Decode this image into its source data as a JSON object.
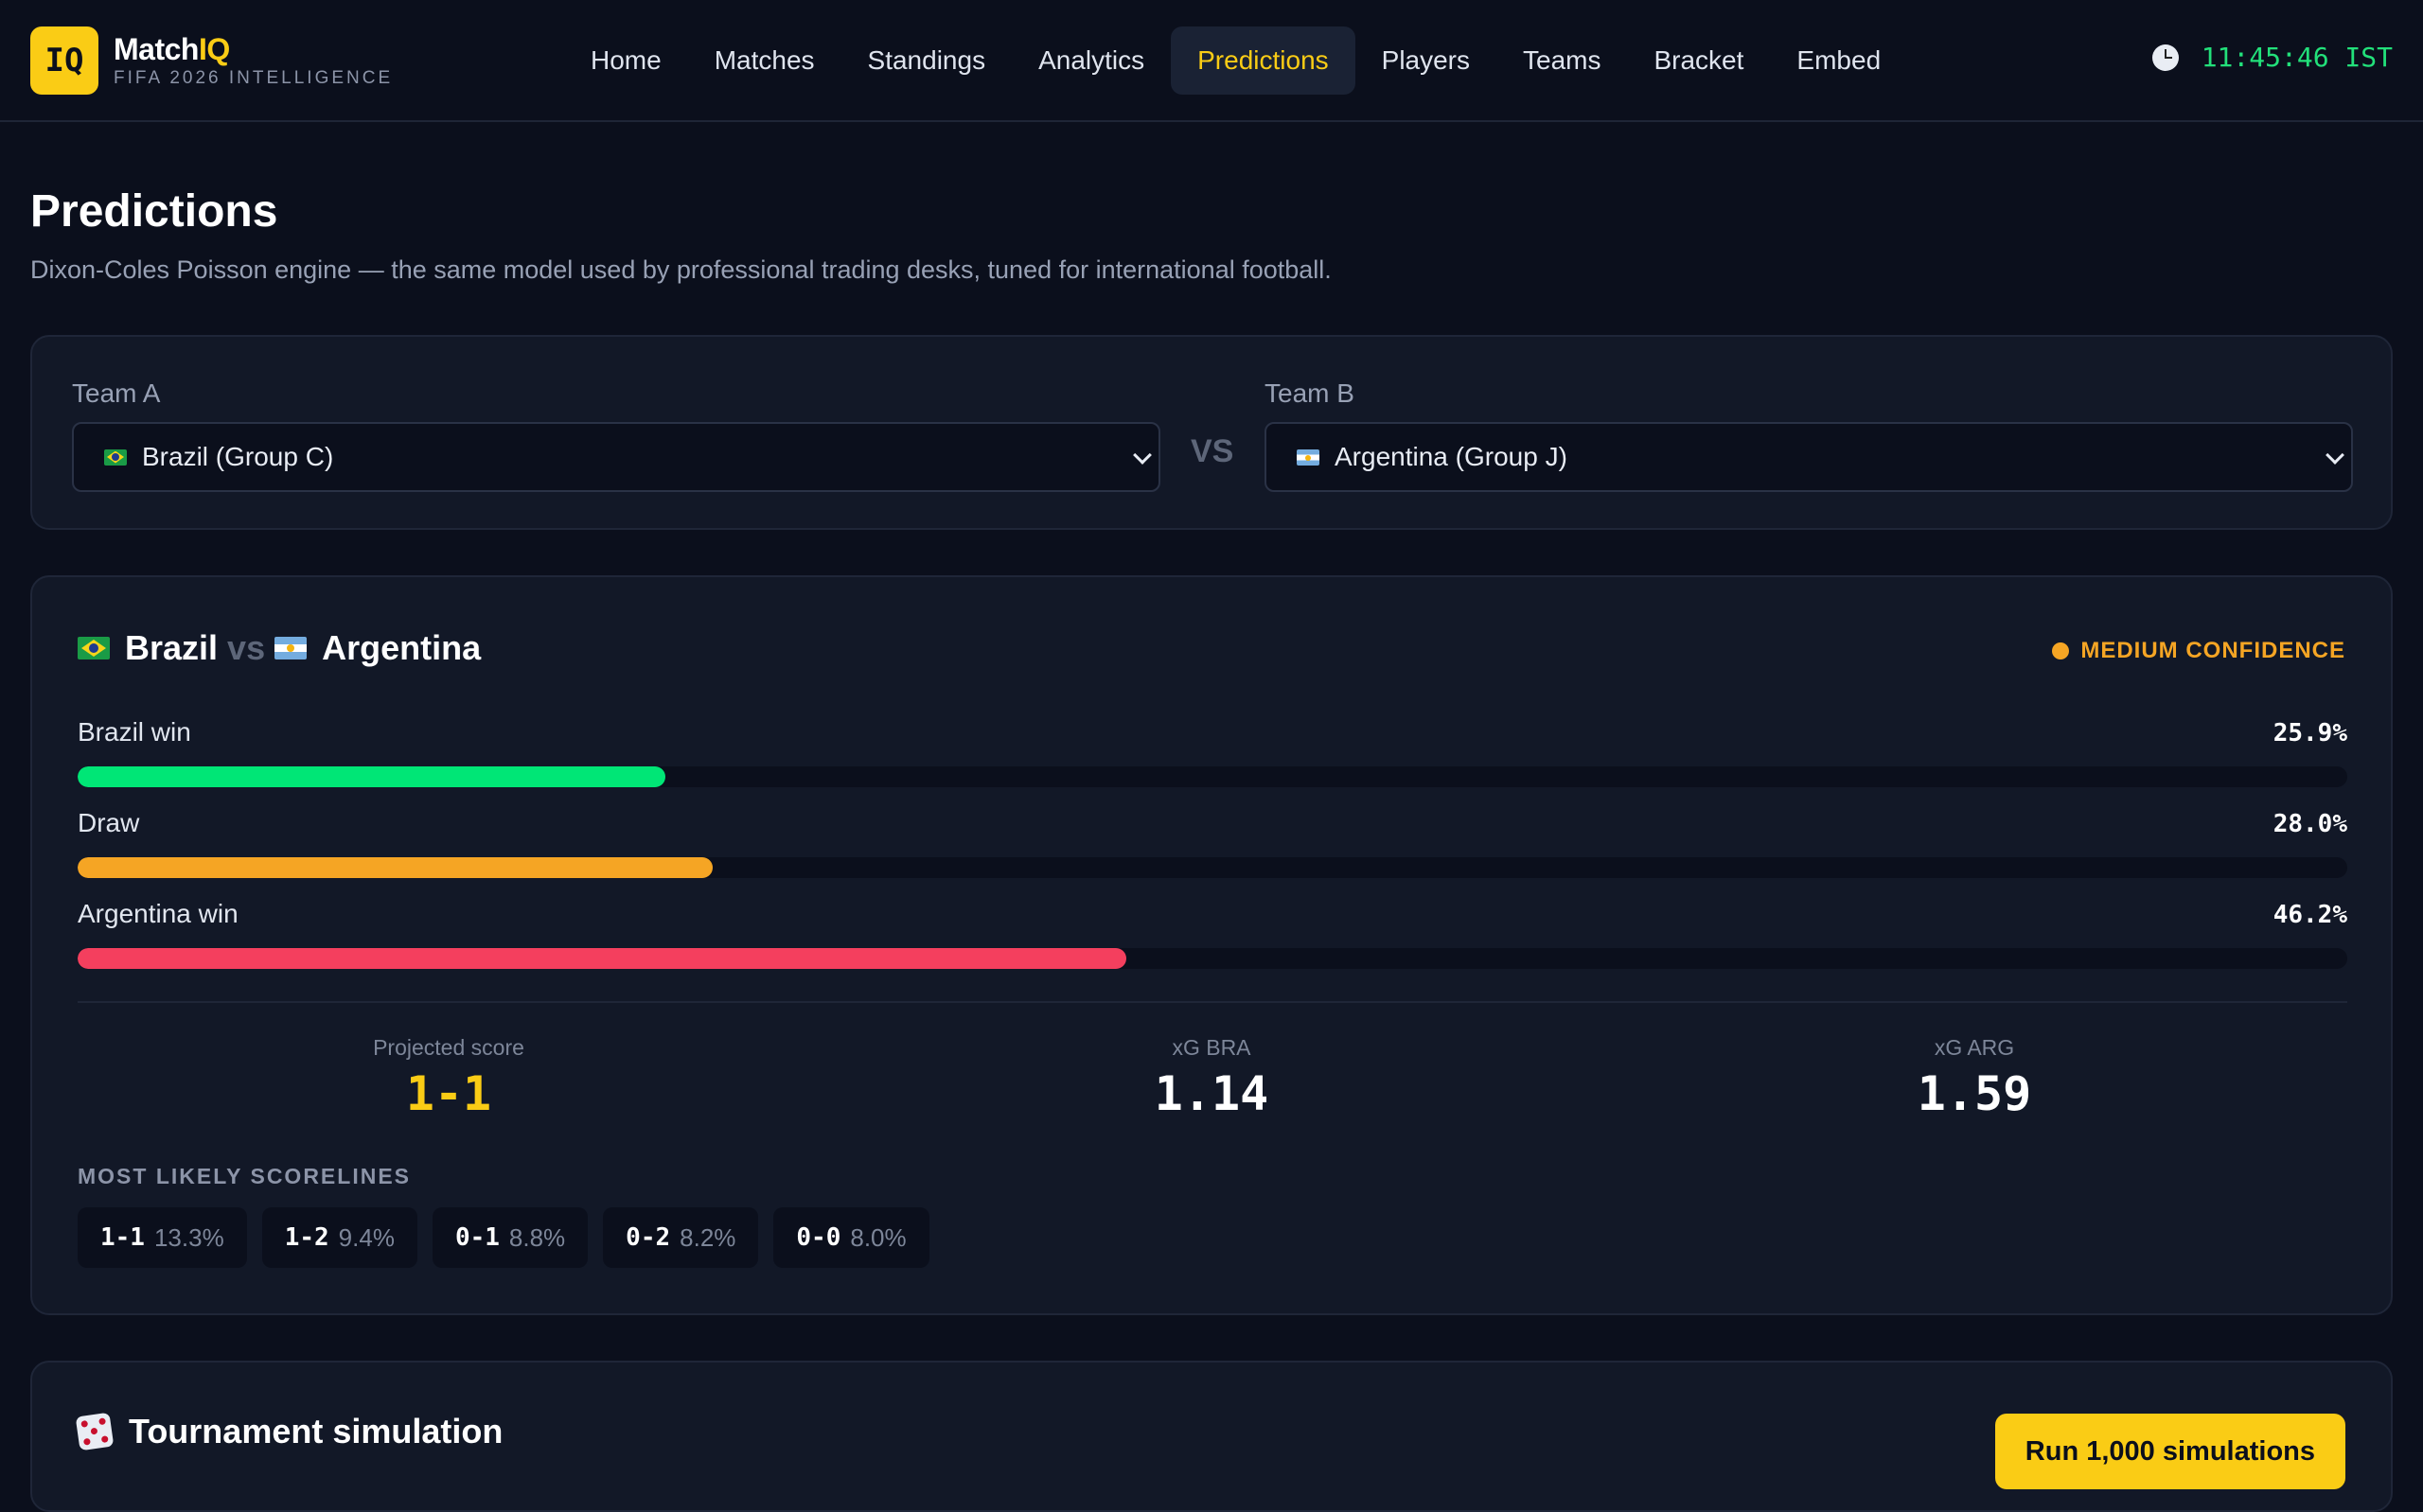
{
  "header": {
    "logo_text": "IQ",
    "brand_main": "Match",
    "brand_accent": "IQ",
    "brand_sub": "FIFA 2026 INTELLIGENCE",
    "nav": [
      "Home",
      "Matches",
      "Standings",
      "Analytics",
      "Predictions",
      "Players",
      "Teams",
      "Bracket",
      "Embed"
    ],
    "active_nav": "Predictions",
    "clock_icon": "clock-icon",
    "clock_time": "11:45:46 IST"
  },
  "page": {
    "title": "Predictions",
    "subtitle": "Dixon-Coles Poisson engine — the same model used by professional trading desks, tuned for international football."
  },
  "selector": {
    "team_a_label": "Team A",
    "team_a_value": "Brazil (Group C)",
    "vs": "VS",
    "team_b_label": "Team B",
    "team_b_value": "Argentina (Group J)"
  },
  "prediction": {
    "team_a": "Brazil",
    "vs": "vs",
    "team_b": "Argentina",
    "confidence": "MEDIUM CONFIDENCE",
    "confidence_color": "#f5a524",
    "outcomes": [
      {
        "label": "Brazil win",
        "value": "25.9%",
        "pct": 25.9,
        "color": "#00e676"
      },
      {
        "label": "Draw",
        "value": "28.0%",
        "pct": 28.0,
        "color": "#f5a524"
      },
      {
        "label": "Argentina win",
        "value": "46.2%",
        "pct": 46.2,
        "color": "#f43f5e"
      }
    ],
    "projected_score_label": "Projected score",
    "projected_score": "1-1",
    "xg_a_label": "xG BRA",
    "xg_a": "1.14",
    "xg_b_label": "xG ARG",
    "xg_b": "1.59",
    "scorelines_title": "MOST LIKELY SCORELINES",
    "scorelines": [
      {
        "score": "1-1",
        "pct": "13.3%"
      },
      {
        "score": "1-2",
        "pct": "9.4%"
      },
      {
        "score": "0-1",
        "pct": "8.8%"
      },
      {
        "score": "0-2",
        "pct": "8.2%"
      },
      {
        "score": "0-0",
        "pct": "8.0%"
      }
    ]
  },
  "simulation": {
    "icon": "dice-icon",
    "title": "Tournament simulation",
    "button": "Run 1,000 simulations"
  }
}
